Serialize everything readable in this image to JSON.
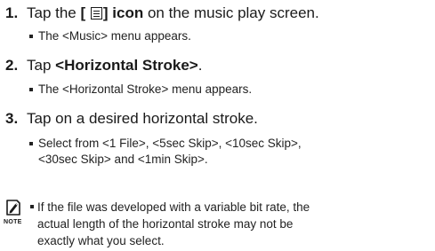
{
  "steps": [
    {
      "number": "1.",
      "prefix": "Tap the ",
      "bold_open": "[",
      "icon": "menu-list-icon",
      "bold_close": "] icon",
      "suffix": " on the music play screen.",
      "bullet": "The <Music> menu appears."
    },
    {
      "number": "2.",
      "prefix": "Tap ",
      "bold": "<Horizontal Stroke>",
      "suffix": ".",
      "bullet": "The <Horizontal Stroke> menu appears."
    },
    {
      "number": "3.",
      "text": "Tap on a desired horizontal stroke.",
      "bullet_line1": "Select from <1 File>, <5sec Skip>, <10sec Skip>,",
      "bullet_line2": "<30sec Skip> and <1min Skip>."
    }
  ],
  "note": {
    "icon": "pencil-note-icon",
    "label": "NOTE",
    "line1": "If the file was developed with a variable bit rate, the",
    "line2": "actual length of the horizontal stroke may not be",
    "line3": "exactly what you select."
  }
}
